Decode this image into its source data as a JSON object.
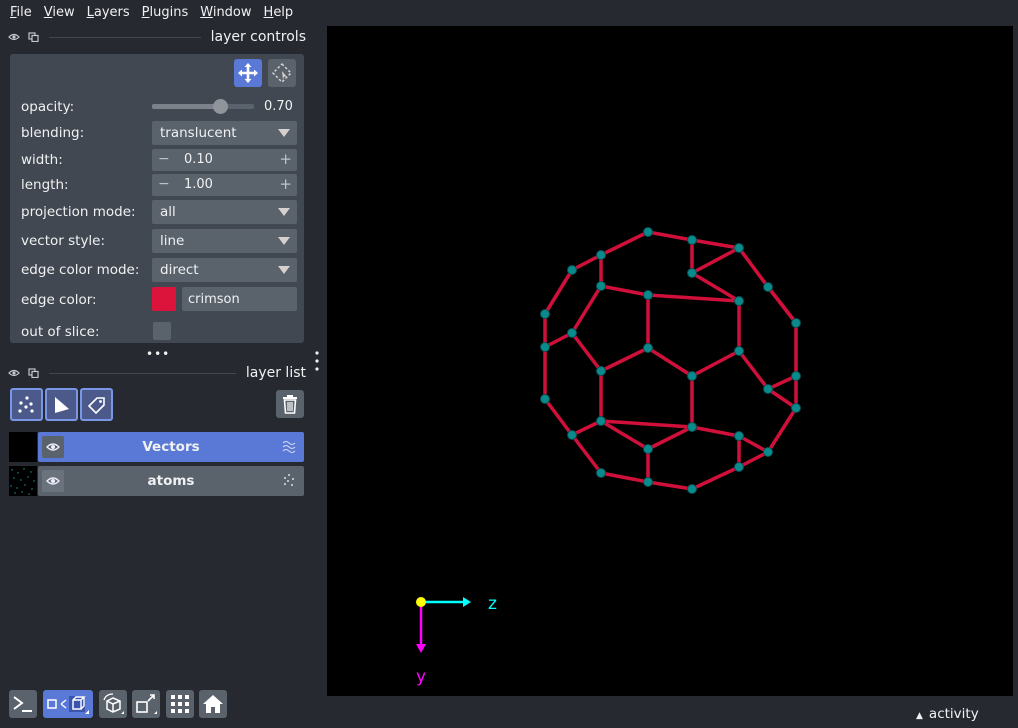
{
  "menu": [
    "File",
    "View",
    "Layers",
    "Plugins",
    "Window",
    "Help"
  ],
  "layer_controls": {
    "title": "layer controls",
    "opacity_label": "opacity:",
    "opacity_value": "0.70",
    "opacity_fraction": 0.7,
    "blending_label": "blending:",
    "blending_value": "translucent",
    "width_label": "width:",
    "width_value": "0.10",
    "length_label": "length:",
    "length_value": "1.00",
    "projection_label": "projection mode:",
    "projection_value": "all",
    "vector_style_label": "vector style:",
    "vector_style_value": "line",
    "edge_color_mode_label": "edge color mode:",
    "edge_color_mode_value": "direct",
    "edge_color_label": "edge color:",
    "edge_color_value": "crimson",
    "edge_color_hex": "#dc143c",
    "out_of_slice_label": "out of slice:"
  },
  "layer_list": {
    "title": "layer list",
    "layers": [
      {
        "name": "Vectors",
        "selected": true,
        "type_icon": "vectors-icon"
      },
      {
        "name": "atoms",
        "selected": false,
        "type_icon": "points-icon"
      }
    ]
  },
  "viewer": {
    "axis_z_label": "z",
    "axis_y_label": "y",
    "bond_color": "#d0103a",
    "atom_color": "#0a8a8a"
  },
  "status": {
    "activity_label": "activity"
  },
  "colors": {
    "accent": "#5a79d6",
    "background": "#262930",
    "panel": "#414851",
    "widget": "#5a626c"
  }
}
